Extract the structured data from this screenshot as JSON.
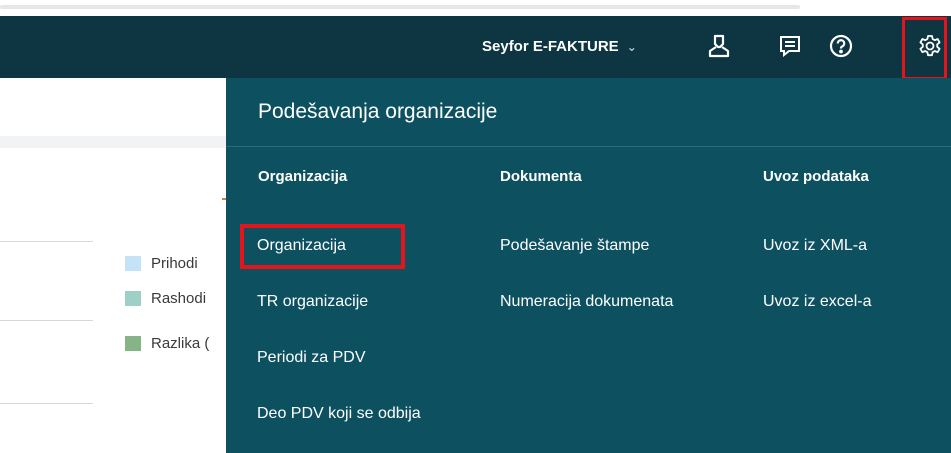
{
  "header": {
    "org_name": "Seyfor E-FAKTURE",
    "chevron": "⌄",
    "icons": [
      "user-icon",
      "messages-icon",
      "help-icon",
      "gear-icon"
    ]
  },
  "legend": [
    {
      "label": "Prihodi",
      "color": "#c5e3f7"
    },
    {
      "label": "Rashodi",
      "color": "#9fd0c8"
    },
    {
      "label": "Razlika (",
      "color": "#86b487"
    }
  ],
  "settings_panel": {
    "title": "Podešavanja organizacije",
    "columns": [
      {
        "heading": "Organizacija",
        "items": [
          "Organizacija",
          "TR organizacije",
          "Periodi za PDV",
          "Deo PDV koji se odbija"
        ]
      },
      {
        "heading": "Dokumenta",
        "items": [
          "Podešavanje štampe",
          "Numeracija dokumenata"
        ]
      },
      {
        "heading": "Uvoz podataka",
        "items": [
          "Uvoz iz XML-a",
          "Uvoz iz excel-a"
        ]
      }
    ]
  },
  "colors": {
    "header_bg": "#0d3642",
    "panel_bg": "#0d5161",
    "highlight": "#e3141b"
  }
}
